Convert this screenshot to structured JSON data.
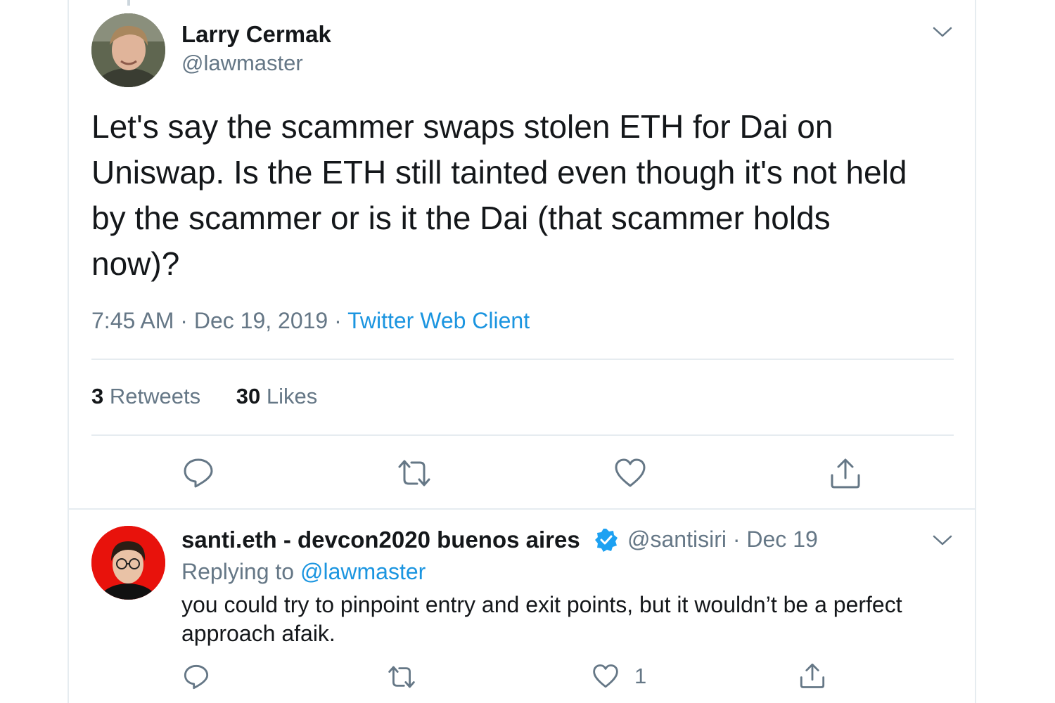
{
  "tweet": {
    "author_name": "Larry Cermak",
    "author_handle": "@lawmaster",
    "text": "Let's say the scammer swaps stolen ETH for Dai on\nUniswap. Is the ETH still tainted even though it's not held\nby the scammer or is it the Dai (that scammer holds\nnow)?",
    "time": "7:45 AM",
    "date": "Dec 19, 2019",
    "separator": " · ",
    "source": "Twitter Web Client",
    "retweets_count": "3",
    "retweets_label": "Retweets",
    "likes_count": "30",
    "likes_label": "Likes"
  },
  "reply": {
    "author_name": "santi.eth - devcon2020 buenos aires",
    "author_handle": "@santisiri",
    "date_sep": " · ",
    "date": "Dec 19",
    "replying_label": "Replying to",
    "replying_to": "@lawmaster",
    "text": "you could try to pinpoint entry and exit points, but it wouldn’t be a perfect approach afaik.",
    "likes_count": "1"
  },
  "icons": {
    "reply": "reply-icon",
    "retweet": "retweet-icon",
    "like": "heart-icon",
    "share": "share-icon",
    "more": "chevron-down-icon",
    "verified": "verified-badge-icon"
  },
  "colors": {
    "link": "#1b95e0",
    "secondary_text": "#657786",
    "primary_text": "#14171a",
    "verified": "#1da1f2"
  }
}
